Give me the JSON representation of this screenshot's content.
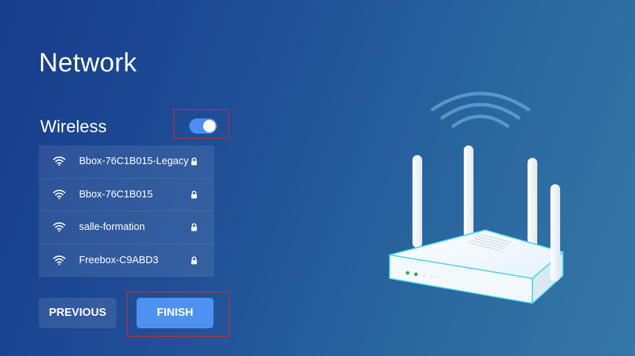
{
  "header": {
    "title": "Network"
  },
  "wireless": {
    "label": "Wireless",
    "enabled": true,
    "networks": [
      {
        "ssid": "Bbox-76C1B015-Legacy",
        "secured": true,
        "icon": "wifi-icon"
      },
      {
        "ssid": "Bbox-76C1B015",
        "secured": true,
        "icon": "wifi-icon"
      },
      {
        "ssid": "salle-formation",
        "secured": true,
        "icon": "wifi-icon"
      },
      {
        "ssid": "Freebox-C9ABD3",
        "secured": true,
        "icon": "wifi-icon"
      }
    ]
  },
  "buttons": {
    "previous_label": "PREVIOUS",
    "finish_label": "FINISH"
  },
  "colors": {
    "background_start": "#173c8c",
    "background_end": "#3577a6",
    "accent": "#4d92f0",
    "highlight": "#e0252b"
  }
}
